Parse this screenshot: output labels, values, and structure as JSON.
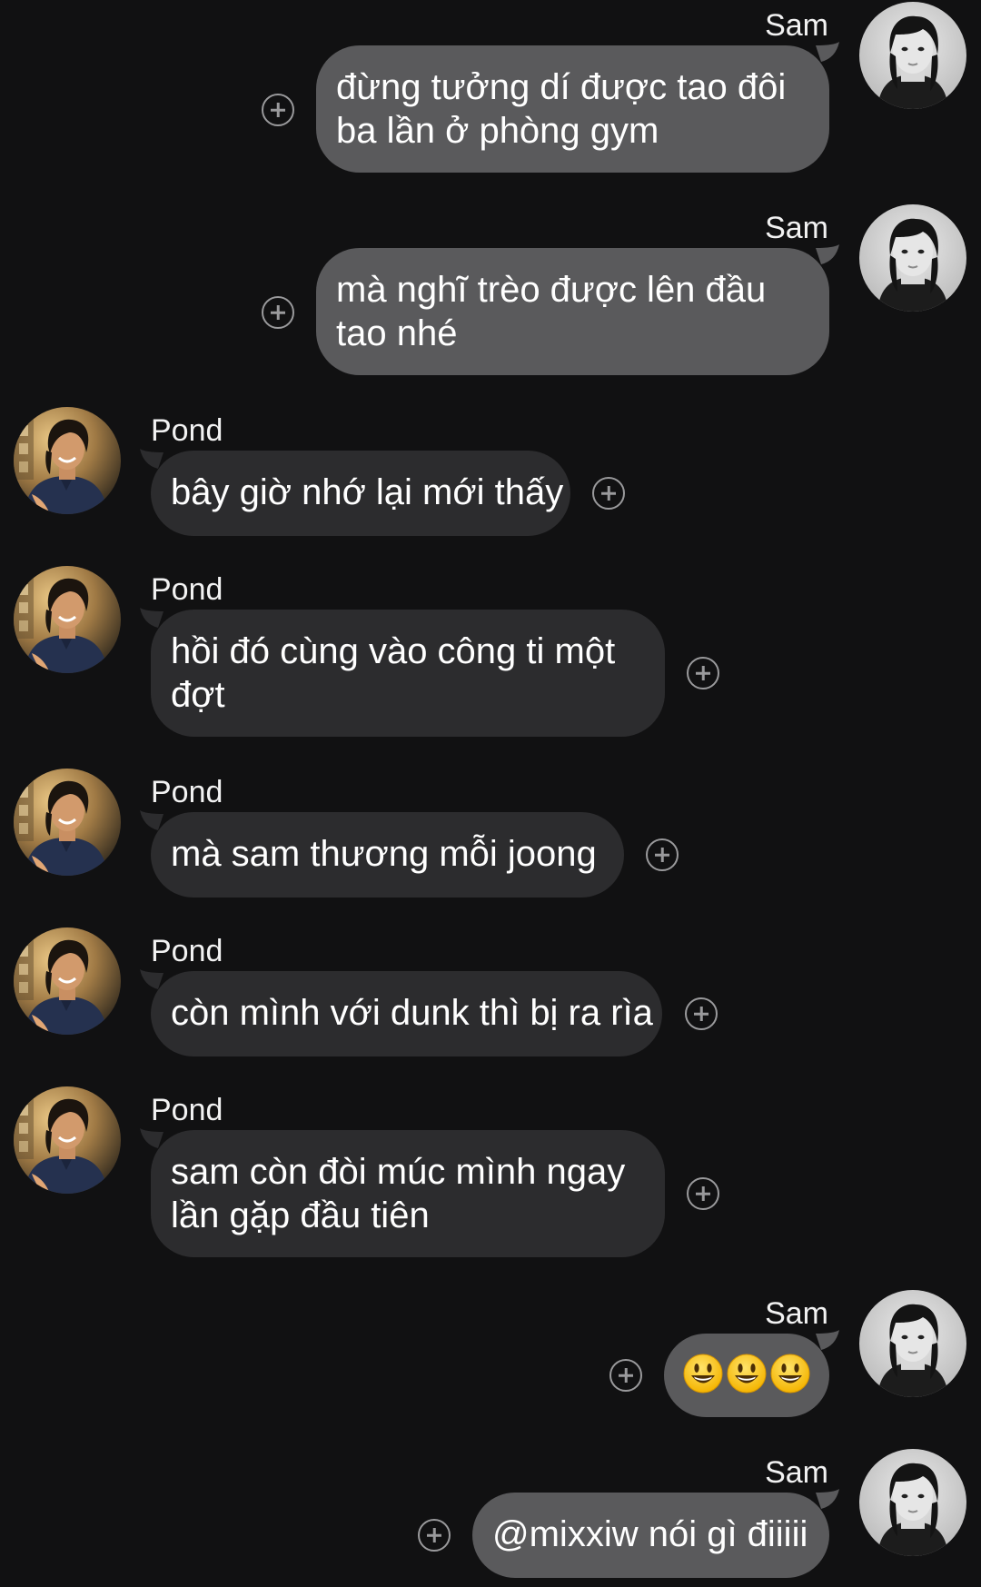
{
  "users": {
    "sam": {
      "name": "Sam"
    },
    "pond": {
      "name": "Pond"
    }
  },
  "messages": [
    {
      "sender": "Sam",
      "text": "đừng tưởng dí được tao đôi ba lần ở phòng gym",
      "line1": "đừng tưởng dí được tao đôi",
      "line2": "ba lần ở phòng gym"
    },
    {
      "sender": "Sam",
      "text": "mà nghĩ trèo được lên đầu tao nhé",
      "line1": "mà nghĩ trèo được lên đầu",
      "line2": "tao nhé"
    },
    {
      "sender": "Pond",
      "text": "bây giờ nhớ lại mới thấy"
    },
    {
      "sender": "Pond",
      "text": "hồi đó cùng vào công ti một đợt",
      "line1": "hồi đó cùng vào công ti một",
      "line2": "đợt"
    },
    {
      "sender": "Pond",
      "text": "mà sam thương mỗi joong"
    },
    {
      "sender": "Pond",
      "text": "còn mình với dunk thì bị ra rìa"
    },
    {
      "sender": "Pond",
      "text": "sam còn đòi múc mình ngay lần gặp đầu tiên",
      "line1": "sam còn đòi múc mình ngay",
      "line2": "lần gặp đầu tiên"
    },
    {
      "sender": "Sam",
      "emoji": [
        "grinning-face",
        "grinning-face",
        "grinning-face"
      ]
    },
    {
      "sender": "Sam",
      "text": "@mixxiw nói gì điiiii"
    }
  ],
  "colors": {
    "background": "#111112",
    "incoming_bubble": "#2c2c2e",
    "outgoing_bubble": "#5a5a5c",
    "react_icon": "#9a9a9c"
  },
  "icons": {
    "react": "add-reaction-icon",
    "avatar_sam": "avatar-sam",
    "avatar_pond": "avatar-pond",
    "emoji": "grinning-face-emoji"
  }
}
